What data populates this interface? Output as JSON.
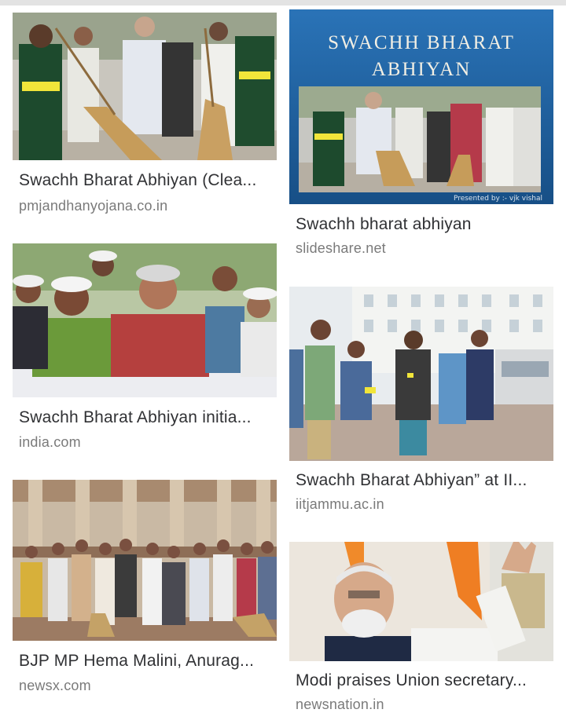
{
  "results": [
    {
      "title": "Swachh Bharat Abhiyan (Clea...",
      "source": "pmjandhanyojana.co.in"
    },
    {
      "title": "Swachh Bharat Abhiyan initia...",
      "source": "india.com"
    },
    {
      "title": "BJP MP Hema Malini, Anurag...",
      "source": "newsx.com"
    },
    {
      "title": "Swachh bharat abhiyan",
      "source": "slideshare.net",
      "image_text": {
        "line1": "SWACHH BHARAT",
        "line2": "ABHIYAN",
        "credit": "Presented by :- vjk vishal"
      }
    },
    {
      "title": "Swachh Bharat Abhiyan” at II...",
      "source": "iitjammu.ac.in"
    },
    {
      "title": "Modi praises Union secretary...",
      "source": "newsnation.in"
    }
  ],
  "colors": {
    "title": "#303134",
    "source": "#7a7a7a",
    "ppt_background": "#1f5f9e"
  }
}
